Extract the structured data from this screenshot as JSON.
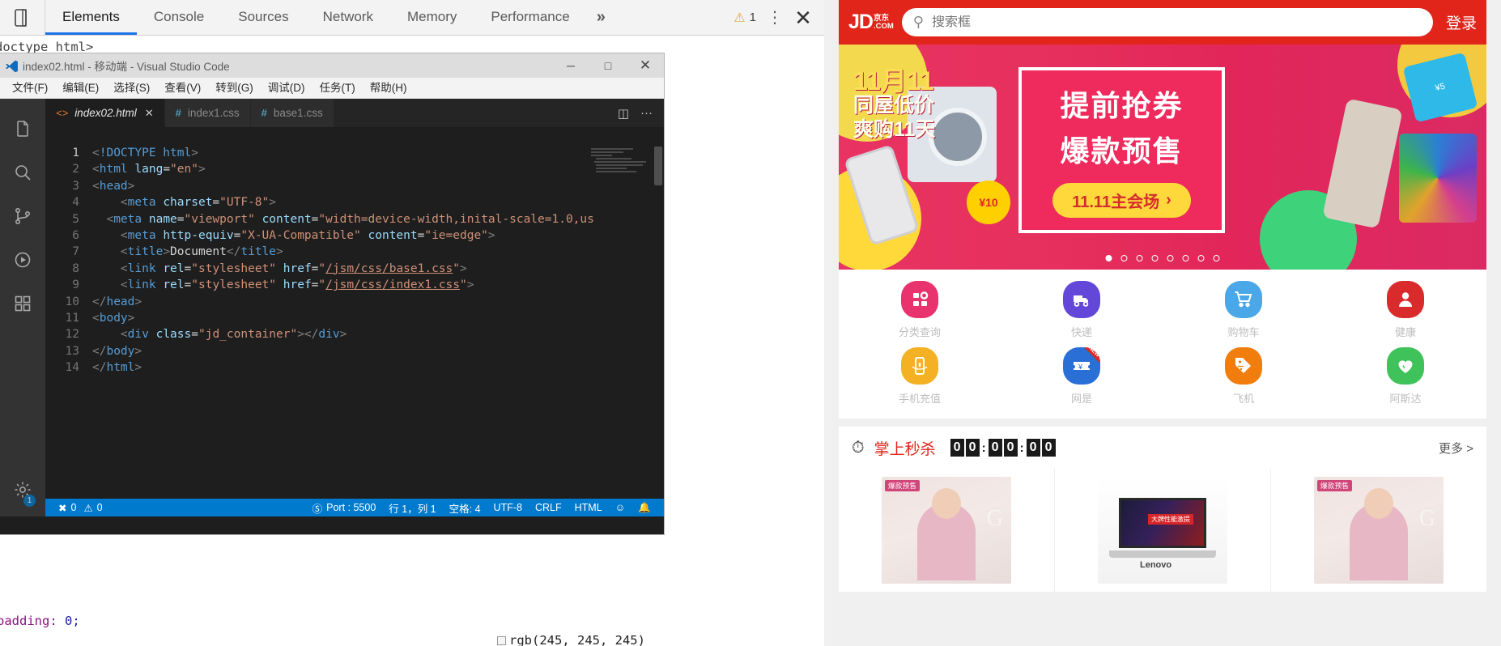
{
  "devtools": {
    "tabs": [
      {
        "label": "Elements",
        "active": true
      },
      {
        "label": "Console",
        "active": false
      },
      {
        "label": "Sources",
        "active": false
      },
      {
        "label": "Network",
        "active": false
      },
      {
        "label": "Memory",
        "active": false
      },
      {
        "label": "Performance",
        "active": false
      }
    ],
    "more_label": "»",
    "warning_count": "1",
    "dom_line": "doctype html>",
    "css_lines": {
      "padding": "padding:",
      "padding_value": "0;",
      "rgb_label": "rgb(245, 245, 245)"
    }
  },
  "vscode": {
    "title": "index02.html - 移动端 - Visual Studio Code",
    "window_buttons": {
      "minimize": "─",
      "maximize": "□",
      "close": "✕"
    },
    "menu": [
      "文件(F)",
      "编辑(E)",
      "选择(S)",
      "查看(V)",
      "转到(G)",
      "调试(D)",
      "任务(T)",
      "帮助(H)"
    ],
    "tabs": [
      {
        "label": "index02.html",
        "kind": "html",
        "active": true,
        "close": "✕"
      },
      {
        "label": "index1.css",
        "kind": "css",
        "active": false,
        "close": ""
      },
      {
        "label": "base1.css",
        "kind": "css",
        "active": false,
        "close": ""
      }
    ],
    "tab_actions": {
      "split": "◫",
      "more": "···"
    },
    "code_lines": [
      {
        "n": "1",
        "text": "<!DOCTYPE html>"
      },
      {
        "n": "2",
        "text": "<html lang=\"en\">"
      },
      {
        "n": "3",
        "text": "<head>"
      },
      {
        "n": "4",
        "text": "    <meta charset=\"UTF-8\">"
      },
      {
        "n": "5",
        "text": "  <meta name=\"viewport\" content=\"width=device-width,inital-scale=1.0,us"
      },
      {
        "n": "6",
        "text": "    <meta http-equiv=\"X-UA-Compatible\" content=\"ie=edge\">"
      },
      {
        "n": "7",
        "text": "    <title>Document</title>"
      },
      {
        "n": "8",
        "text": "    <link rel=\"stylesheet\" href=\"/jsm/css/base1.css\">"
      },
      {
        "n": "9",
        "text": "    <link rel=\"stylesheet\" href=\"/jsm/css/index1.css\">"
      },
      {
        "n": "10",
        "text": "</head>"
      },
      {
        "n": "11",
        "text": "<body>"
      },
      {
        "n": "12",
        "text": "    <div class=\"jd_container\"></div>"
      },
      {
        "n": "13",
        "text": "</body>"
      },
      {
        "n": "14",
        "text": "</html>"
      }
    ],
    "status": {
      "errors": "0",
      "warnings": "0",
      "port": "Port : 5500",
      "position": "行 1，列 1",
      "spaces": "空格: 4",
      "encoding": "UTF-8",
      "eol": "CRLF",
      "language": "HTML",
      "smiley": "☺",
      "bell": "🔔"
    }
  },
  "jd": {
    "header": {
      "logo_main": "JD",
      "logo_cn": "京东",
      "logo_com": ".COM",
      "search_placeholder": "搜索框",
      "login_label": "登录"
    },
    "banner": {
      "left_line1": "11月11",
      "left_line2": "同屋低价",
      "left_line3": "爽购11天",
      "title_line1": "提前抢券",
      "title_line2": "爆款预售",
      "cta": "11.11主会场",
      "cta_arrow": "›",
      "dot_count": 8,
      "active_dot": 0,
      "badge_coin": "¥10",
      "badge_card": "¥5"
    },
    "nav": [
      {
        "label": "分类查询",
        "icon": "grid-icon",
        "color": "#e8336e",
        "badge": false
      },
      {
        "label": "快递",
        "icon": "truck-icon",
        "color": "#6347d8",
        "badge": false
      },
      {
        "label": "购物车",
        "icon": "cart-icon",
        "color": "#4aa8e8",
        "badge": false
      },
      {
        "label": "健康",
        "icon": "person-icon",
        "color": "#d92b2b",
        "badge": false
      },
      {
        "label": "手机充值",
        "icon": "phone-recharge-icon",
        "color": "#f4b124",
        "badge": false
      },
      {
        "label": "网是",
        "icon": "coupon-icon",
        "color": "#2a6fd6",
        "badge": true,
        "badge_text": "NEW"
      },
      {
        "label": "飞机",
        "icon": "price-tag-icon",
        "color": "#f07d0c",
        "badge": false
      },
      {
        "label": "阿斯达",
        "icon": "heart-icon",
        "color": "#3fc25a",
        "badge": false
      }
    ],
    "seckill": {
      "clock_icon": "stopwatch-icon",
      "title": "掌上秒杀",
      "digits": [
        "0",
        "0",
        "0",
        "0",
        "0",
        "0"
      ],
      "colon": ":",
      "more_label": "更多",
      "more_arrow": ">"
    },
    "goods": [
      {
        "tag": "爆款预售",
        "kind": "model",
        "letter": "G"
      },
      {
        "tag": "",
        "kind": "laptop",
        "letter": "",
        "brand": "Lenovo",
        "promo": "大牌性能激提"
      },
      {
        "tag": "爆款预售",
        "kind": "model",
        "letter": "G"
      }
    ]
  }
}
